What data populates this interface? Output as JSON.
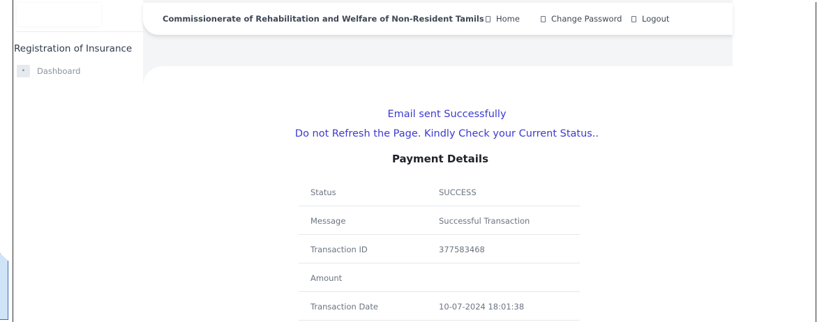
{
  "header": {
    "title": "Commissionerate of Rehabilitation and Welfare of Non-Resident Tamils",
    "links": [
      {
        "label": "Home",
        "icon": "square-icon"
      },
      {
        "label": "Change Password",
        "icon": "square-icon"
      },
      {
        "label": "Logout",
        "icon": "square-icon"
      }
    ]
  },
  "sidebar": {
    "title": "Registration of Insurance",
    "items": [
      {
        "label": "Dashboard",
        "icon": "dot-icon"
      }
    ]
  },
  "messages": {
    "email_sent": "Email sent Successfully",
    "refresh_warning": "Do not Refresh the Page. Kindly Check your Current Status.."
  },
  "payment": {
    "title": "Payment Details",
    "rows": [
      {
        "label": "Status",
        "value": "SUCCESS"
      },
      {
        "label": "Message",
        "value": "Successful Transaction"
      },
      {
        "label": "Transaction ID",
        "value": "377583468"
      },
      {
        "label": "Amount",
        "value": ""
      },
      {
        "label": "Transaction Date",
        "value": "10-07-2024 18:01:38"
      }
    ]
  },
  "colors": {
    "message_text": "#3b3ad1",
    "page_background": "#f4f5f7",
    "card_background": "#ffffff"
  }
}
